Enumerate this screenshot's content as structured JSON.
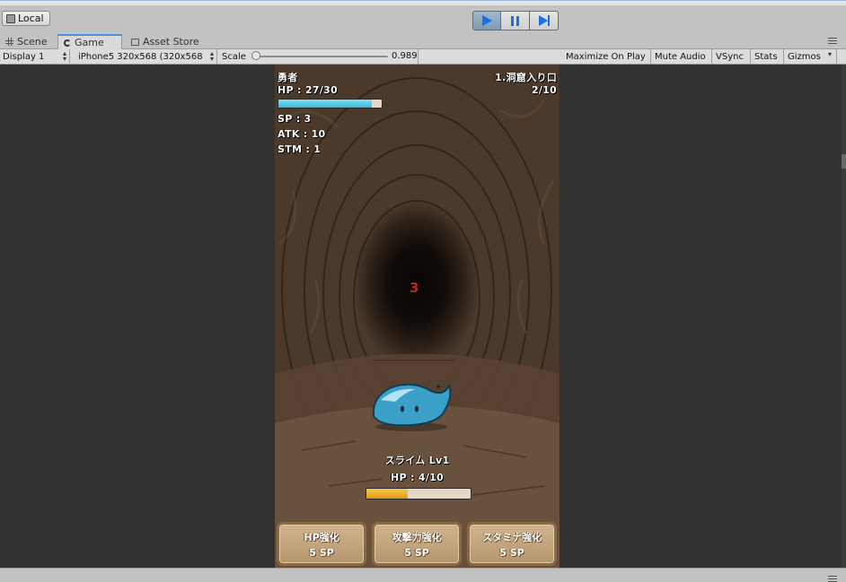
{
  "toolbar": {
    "local_label": "Local"
  },
  "tabs": {
    "scene": "Scene",
    "game": "Game",
    "asset_store": "Asset Store"
  },
  "gamebar": {
    "display": "Display 1",
    "aspect": "iPhone5 320x568 (320x568",
    "scale_label": "Scale",
    "scale_value": "0.989",
    "maximize": "Maximize On Play",
    "mute": "Mute Audio",
    "vsync": "VSync",
    "stats": "Stats",
    "gizmos": "Gizmos"
  },
  "game": {
    "player": {
      "name": "勇者",
      "hp_text": "HP : 27/30",
      "hp_fraction": 0.9,
      "sp_text": "SP : 3",
      "atk_text": "ATK : 10",
      "stm_text": "STM : 1"
    },
    "stage": {
      "name": "1.洞窟入り口",
      "progress": "2/10"
    },
    "damage_number": "3",
    "enemy": {
      "name": "スライム Lv1",
      "hp_text": "HP : 4/10",
      "hp_fraction": 0.4
    },
    "buttons": [
      {
        "title": "HP強化",
        "cost": "5 SP"
      },
      {
        "title": "攻撃力強化",
        "cost": "5 SP"
      },
      {
        "title": "スタミナ強化",
        "cost": "5 SP"
      }
    ]
  },
  "colors": {
    "player_hp": "#4cc3de",
    "enemy_hp": "#eeb02e",
    "damage": "#b8282a",
    "play_accent": "#1b6fe0"
  }
}
